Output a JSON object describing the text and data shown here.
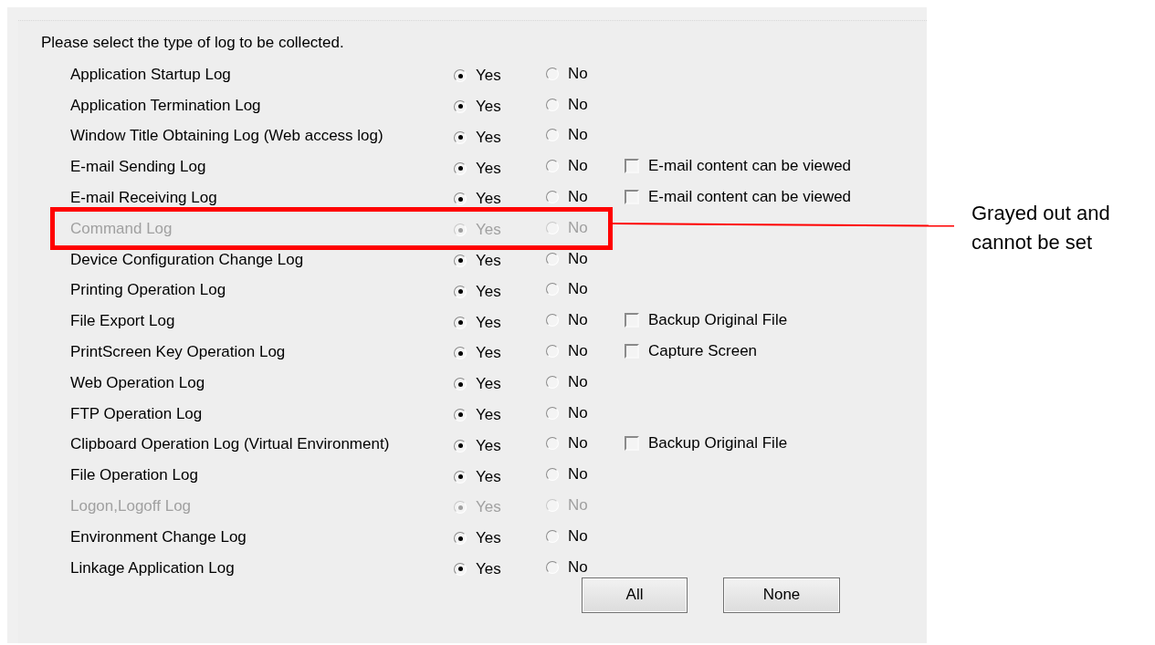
{
  "instruction": "Please select the type of log to be collected.",
  "rows": [
    {
      "label": "Application Startup Log",
      "disabled": false,
      "options": [
        {
          "label": "Yes",
          "selected": true
        },
        {
          "label": "No",
          "selected": false
        }
      ]
    },
    {
      "label": "Application Termination Log",
      "disabled": false,
      "options": [
        {
          "label": "Yes",
          "selected": true
        },
        {
          "label": "No",
          "selected": false
        }
      ]
    },
    {
      "label": "Window Title Obtaining Log (Web access log)",
      "disabled": false,
      "options": [
        {
          "label": "Yes",
          "selected": true
        },
        {
          "label": "No",
          "selected": false
        }
      ]
    },
    {
      "label": "E-mail Sending Log",
      "disabled": false,
      "options": [
        {
          "label": "Yes",
          "selected": true
        },
        {
          "label": "No",
          "selected": false
        }
      ],
      "checkbox": {
        "label": "E-mail content can be viewed",
        "checked": false
      }
    },
    {
      "label": "E-mail Receiving Log",
      "disabled": false,
      "options": [
        {
          "label": "Yes",
          "selected": true
        },
        {
          "label": "No",
          "selected": false
        }
      ],
      "checkbox": {
        "label": "E-mail content can be viewed",
        "checked": false
      }
    },
    {
      "label": "Command Log",
      "disabled": true,
      "options": [
        {
          "label": "Yes",
          "selected": true
        },
        {
          "label": "No",
          "selected": false
        }
      ]
    },
    {
      "label": "Device Configuration Change Log",
      "disabled": false,
      "options": [
        {
          "label": "Yes",
          "selected": true
        },
        {
          "label": "No",
          "selected": false
        }
      ]
    },
    {
      "label": "Printing Operation Log",
      "disabled": false,
      "options": [
        {
          "label": "Yes",
          "selected": true
        },
        {
          "label": "No",
          "selected": false
        }
      ]
    },
    {
      "label": "File Export Log",
      "disabled": false,
      "options": [
        {
          "label": "Yes",
          "selected": true
        },
        {
          "label": "No",
          "selected": false
        }
      ],
      "checkbox": {
        "label": "Backup Original File",
        "checked": false
      }
    },
    {
      "label": "PrintScreen Key Operation Log",
      "disabled": false,
      "options": [
        {
          "label": "Yes",
          "selected": true
        },
        {
          "label": "No",
          "selected": false
        }
      ],
      "checkbox": {
        "label": "Capture Screen",
        "checked": false
      }
    },
    {
      "label": "Web Operation Log",
      "disabled": false,
      "options": [
        {
          "label": "Yes",
          "selected": true
        },
        {
          "label": "No",
          "selected": false
        }
      ]
    },
    {
      "label": "FTP Operation Log",
      "disabled": false,
      "options": [
        {
          "label": "Yes",
          "selected": true
        },
        {
          "label": "No",
          "selected": false
        }
      ]
    },
    {
      "label": "Clipboard Operation Log (Virtual Environment)",
      "disabled": false,
      "options": [
        {
          "label": "Yes",
          "selected": true
        },
        {
          "label": "No",
          "selected": false
        }
      ],
      "checkbox": {
        "label": "Backup Original File",
        "checked": false
      }
    },
    {
      "label": "File Operation Log",
      "disabled": false,
      "options": [
        {
          "label": "Yes",
          "selected": true
        },
        {
          "label": "No",
          "selected": false
        }
      ]
    },
    {
      "label": "Logon,Logoff Log",
      "disabled": true,
      "options": [
        {
          "label": "Yes",
          "selected": true
        },
        {
          "label": "No",
          "selected": false
        }
      ]
    },
    {
      "label": "Environment Change Log",
      "disabled": false,
      "options": [
        {
          "label": "Yes",
          "selected": true
        },
        {
          "label": "No",
          "selected": false
        }
      ]
    },
    {
      "label": "Linkage Application Log",
      "disabled": false,
      "options": [
        {
          "label": "Yes",
          "selected": true
        },
        {
          "label": "No",
          "selected": false
        }
      ]
    }
  ],
  "buttons": [
    "All",
    "None"
  ],
  "annotation": {
    "text": "Grayed out and cannot be set"
  }
}
